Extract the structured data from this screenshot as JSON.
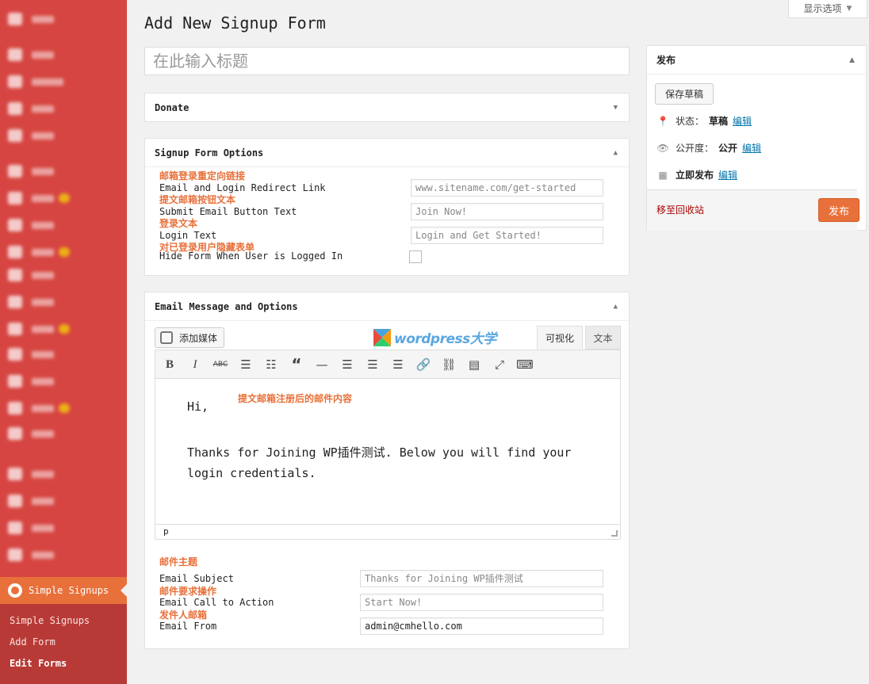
{
  "screen_options": {
    "label": "显示选项"
  },
  "page": {
    "title": "Add New Signup Form",
    "title_placeholder": "在此输入标题"
  },
  "donate": {
    "title": "Donate"
  },
  "signup_options": {
    "title": "Signup Form Options",
    "fields": [
      {
        "annotation": "邮箱登录重定向链接",
        "label": "Email and Login Redirect Link",
        "placeholder": "www.sitename.com/get-started"
      },
      {
        "annotation": "提文邮箱按钮文本",
        "label": "Submit Email Button Text",
        "placeholder": "Join Now!"
      },
      {
        "annotation": "登录文本",
        "label": "Login Text",
        "placeholder": "Login and Get Started!"
      },
      {
        "annotation": "对已登录用户隐藏表单",
        "label": "Hide Form When User is Logged In"
      }
    ]
  },
  "email_options": {
    "title": "Email Message and Options",
    "add_media": "添加媒体",
    "logo_text": "wordpress大学",
    "tab_visual": "可视化",
    "tab_text": "文本",
    "editor_annotation": "提文邮箱注册后的邮件内容",
    "editor_lines": [
      "Hi,",
      "Thanks for Joining WP插件测试. Below you will find your",
      "login credentials."
    ],
    "status_path": "p",
    "fields": [
      {
        "annotation": "邮件主题",
        "label": "Email Subject",
        "placeholder": "Thanks for Joining WP插件测试"
      },
      {
        "annotation": "邮件要求操作",
        "label": "Email Call to Action",
        "placeholder": "Start Now!"
      },
      {
        "annotation": "发件人邮箱",
        "label": "Email From",
        "value": "admin@cmhello.com"
      }
    ]
  },
  "publish": {
    "title": "发布",
    "save_draft": "保存草稿",
    "status_label": "状态：",
    "status_value": "草稿",
    "visibility_label": "公开度：",
    "visibility_value": "公开",
    "schedule_label": "立即发布",
    "edit_link": "编辑",
    "trash": "移至回收站",
    "publish_button": "发布"
  },
  "sidebar": {
    "active": "Simple Signups",
    "submenu": [
      "Simple Signups",
      "Add Form",
      "Edit Forms"
    ]
  },
  "colors": {
    "sidebar": "#d64541",
    "accent": "#e8703a",
    "link": "#0073aa"
  }
}
